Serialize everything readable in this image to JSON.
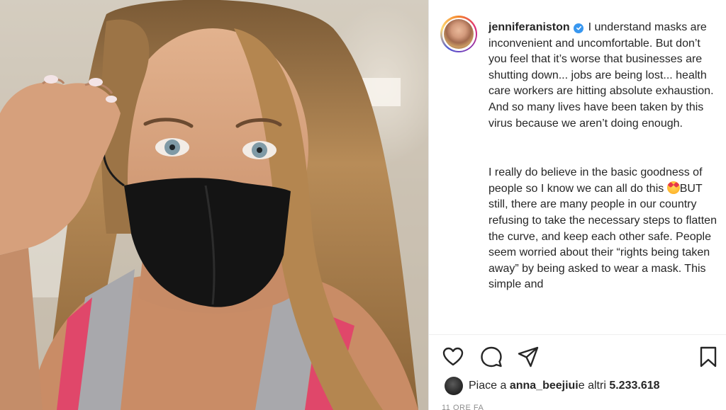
{
  "post": {
    "username": "jenniferaniston",
    "caption_para1": "I understand masks are inconvenient and uncomfortable. But don’t you feel that it’s worse that businesses are shutting down... jobs are being lost... health care workers are hitting absolute exhaustion. And so many lives have been taken by this virus because we aren’t doing enough.",
    "caption_para2_before": "I really do believe in the basic goodness of people so I know we can all do this ",
    "caption_para2_after": "BUT still, there are many people in our country refusing to take the necessary steps to flatten the curve, and keep each other safe. People seem worried about their “rights being taken away” by being asked to wear a mask. This simple and",
    "likes": {
      "prefix": "Piace a ",
      "name": "anna_beejiui",
      "middle": " e altri ",
      "count": "5.233.618"
    },
    "timestamp": "11 ORE FA"
  },
  "icons": {
    "verified": "verified-badge-icon",
    "emoji": "smiling-face-with-hearts-emoji",
    "like": "heart-icon",
    "comment": "comment-bubble-icon",
    "share": "paper-plane-icon",
    "save": "bookmark-icon"
  },
  "colors": {
    "verified_blue": "#3897f0",
    "text": "#262626",
    "muted": "#8e8e8e"
  }
}
